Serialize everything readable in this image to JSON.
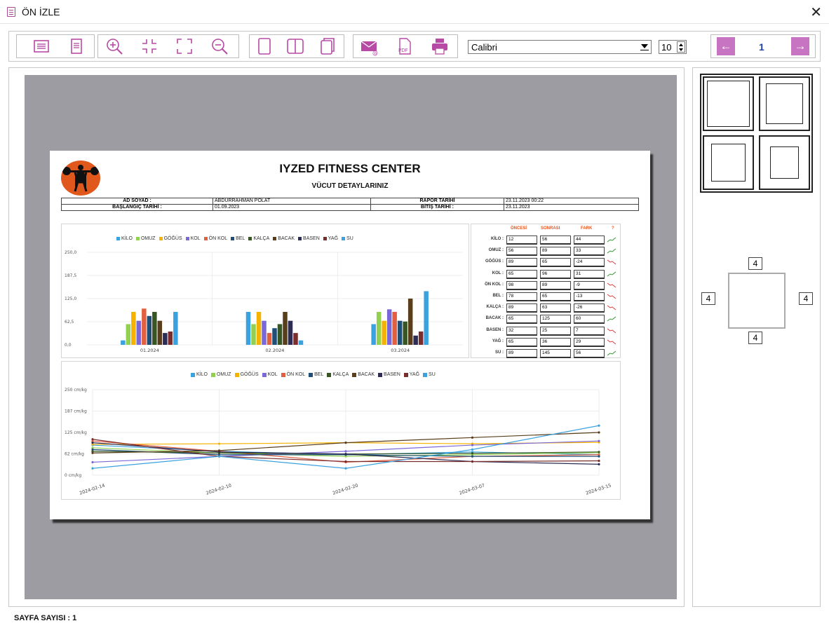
{
  "window": {
    "title": "ÖN İZLE",
    "close_icon": "close-icon"
  },
  "toolbar": {
    "font_value": "Calibri",
    "font_size": "10",
    "page_number": "1",
    "nav_color": "#c775c3",
    "icon_color": "#b74aa5"
  },
  "report": {
    "title": "IYZED FITNESS CENTER",
    "subtitle": "VÜCUT DETAYLARINIZ",
    "info": {
      "ad_soyad_label": "AD SOYAD :",
      "ad_soyad_value": "ABDURRAHMAN POLAT",
      "rapor_tarihi_label": "RAPOR TARİHİ",
      "rapor_tarihi_value": "23.11.2023 00:22",
      "baslangic_label": "BAŞLANGIÇ TARİHİ :",
      "baslangic_value": "01.09.2023",
      "bitis_label": "BİTİŞ TARİHİ :",
      "bitis_value": "23.11.2023"
    },
    "stats_headers": {
      "before": "ÖNCESİ",
      "after": "SONRASI",
      "diff": "FARK",
      "trend": "?"
    },
    "stats_rows": [
      {
        "label": "KİLO :",
        "before": "12",
        "after": "56",
        "diff": "44",
        "trend": "up"
      },
      {
        "label": "OMUZ :",
        "before": "56",
        "after": "89",
        "diff": "33",
        "trend": "up"
      },
      {
        "label": "GÖĞÜS :",
        "before": "89",
        "after": "65",
        "diff": "-24",
        "trend": "down"
      },
      {
        "label": "KOL :",
        "before": "65",
        "after": "96",
        "diff": "31",
        "trend": "up"
      },
      {
        "label": "ÖN KOL :",
        "before": "98",
        "after": "89",
        "diff": "-9",
        "trend": "down"
      },
      {
        "label": "BEL :",
        "before": "78",
        "after": "65",
        "diff": "-13",
        "trend": "down"
      },
      {
        "label": "KALÇA :",
        "before": "89",
        "after": "63",
        "diff": "-26",
        "trend": "down"
      },
      {
        "label": "BACAK :",
        "before": "65",
        "after": "125",
        "diff": "60",
        "trend": "up"
      },
      {
        "label": "BASEN :",
        "before": "32",
        "after": "25",
        "diff": "7",
        "trend": "down"
      },
      {
        "label": "YAĞ :",
        "before": "65",
        "after": "36",
        "diff": "29",
        "trend": "down"
      },
      {
        "label": "SU :",
        "before": "89",
        "after": "145",
        "diff": "56",
        "trend": "up"
      }
    ]
  },
  "side": {
    "margin_top": "4",
    "margin_left": "4",
    "margin_right": "4",
    "margin_bottom": "4"
  },
  "footer": {
    "page_count": "SAYFA SAYISI : 1"
  },
  "chart_data": [
    {
      "type": "bar",
      "categories": [
        "01.2024",
        "02.2024",
        "03.2024"
      ],
      "ylim": [
        0,
        250
      ],
      "yticks": [
        "250,0",
        "187,5",
        "125,0",
        "62,5",
        "0,0"
      ],
      "series": [
        {
          "name": "KİLO",
          "color": "#3ba2e0",
          "values": [
            12,
            89,
            56
          ]
        },
        {
          "name": "OMUZ",
          "color": "#92d050",
          "values": [
            56,
            56,
            89
          ]
        },
        {
          "name": "GÖĞÜS",
          "color": "#f5b300",
          "values": [
            89,
            89,
            65
          ]
        },
        {
          "name": "KOL",
          "color": "#7b68d8",
          "values": [
            65,
            65,
            96
          ]
        },
        {
          "name": "ÖN KOL",
          "color": "#e06040",
          "values": [
            98,
            32,
            89
          ]
        },
        {
          "name": "BEL",
          "color": "#1f4e79",
          "values": [
            78,
            45,
            65
          ]
        },
        {
          "name": "KALÇA",
          "color": "#375623",
          "values": [
            89,
            56,
            63
          ]
        },
        {
          "name": "BACAK",
          "color": "#5a3e1b",
          "values": [
            65,
            89,
            125
          ]
        },
        {
          "name": "BASEN",
          "color": "#2c2c54",
          "values": [
            32,
            65,
            25
          ]
        },
        {
          "name": "YAĞ",
          "color": "#7b2d2d",
          "values": [
            36,
            32,
            36
          ]
        },
        {
          "name": "SU",
          "color": "#3ba2e0",
          "values": [
            89,
            12,
            145
          ]
        }
      ]
    },
    {
      "type": "line",
      "x": [
        "2024-02-14",
        "2024-02-10",
        "2024-02-20",
        "2024-03-07",
        "2024-03-15"
      ],
      "ylim": [
        0,
        250
      ],
      "yticks": [
        "250 cm/kg",
        "187 cm/kg",
        "125 cm/kg",
        "62 cm/kg",
        "0 cm/kg"
      ],
      "series": [
        {
          "name": "KİLO",
          "color": "#3ba2e0",
          "values": [
            88,
            70,
            60,
            68,
            60
          ]
        },
        {
          "name": "OMUZ",
          "color": "#92d050",
          "values": [
            80,
            65,
            55,
            60,
            66
          ]
        },
        {
          "name": "GÖĞÜS",
          "color": "#f5b300",
          "values": [
            90,
            92,
            95,
            92,
            96
          ]
        },
        {
          "name": "KOL",
          "color": "#7b68d8",
          "values": [
            38,
            55,
            70,
            88,
            100
          ]
        },
        {
          "name": "ÖN KOL",
          "color": "#e06040",
          "values": [
            100,
            70,
            38,
            55,
            60
          ]
        },
        {
          "name": "BEL",
          "color": "#1f4e79",
          "values": [
            75,
            60,
            60,
            55,
            55
          ]
        },
        {
          "name": "KALÇA",
          "color": "#375623",
          "values": [
            70,
            65,
            62,
            64,
            68
          ]
        },
        {
          "name": "BACAK",
          "color": "#5a3e1b",
          "values": [
            65,
            72,
            95,
            110,
            125
          ]
        },
        {
          "name": "BASEN",
          "color": "#2c2c54",
          "values": [
            95,
            68,
            62,
            40,
            32
          ]
        },
        {
          "name": "YAĞ",
          "color": "#7b2d2d",
          "values": [
            105,
            55,
            40,
            40,
            42
          ]
        },
        {
          "name": "SU",
          "color": "#3ba2e0",
          "values": [
            20,
            55,
            20,
            75,
            145
          ]
        }
      ]
    }
  ]
}
